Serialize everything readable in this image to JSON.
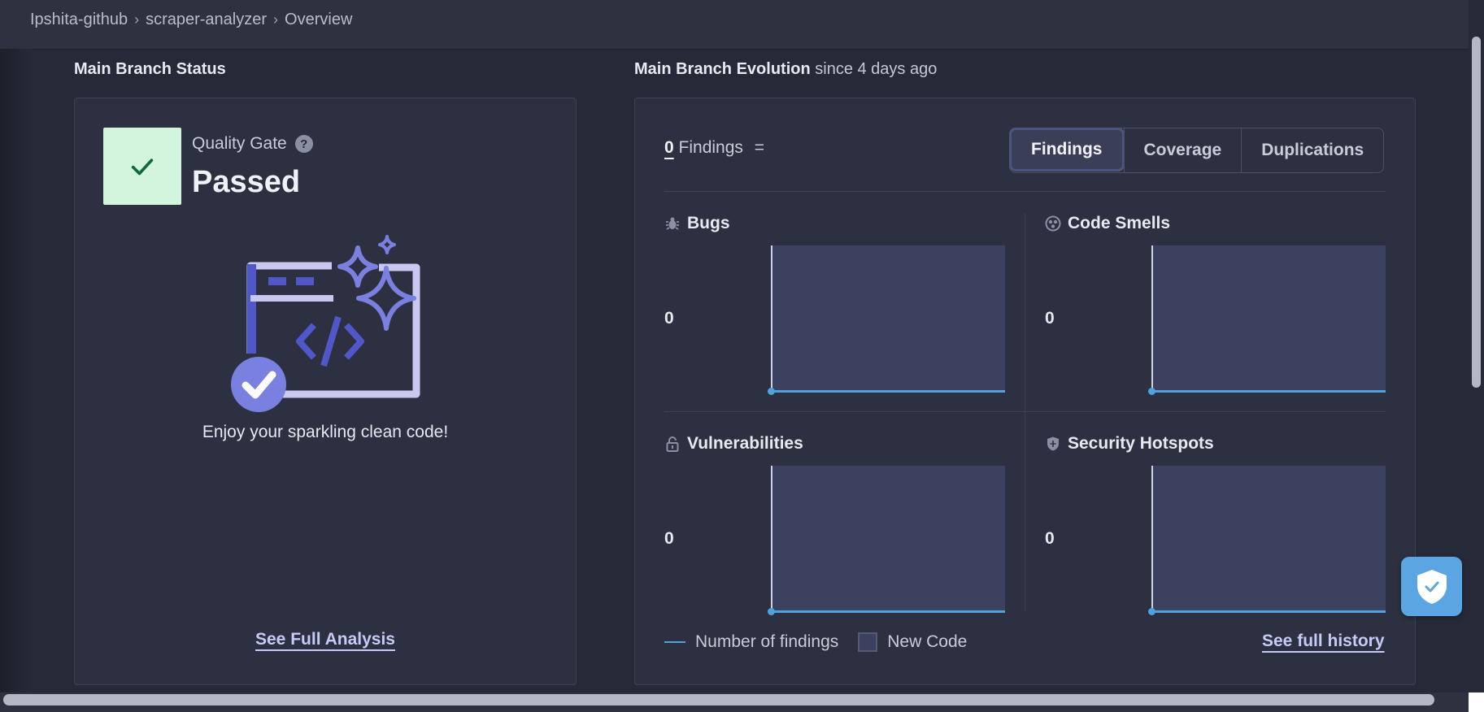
{
  "breadcrumb": {
    "items": [
      {
        "label": "Ipshita-github"
      },
      {
        "label": "scraper-analyzer"
      },
      {
        "label": "Overview"
      }
    ]
  },
  "status_section": {
    "title": "Main Branch Status",
    "quality_gate_label": "Quality Gate",
    "help": "?",
    "status": "Passed",
    "message": "Enjoy your sparkling clean code!",
    "link": "See Full Analysis"
  },
  "evolution_section": {
    "title": "Main Branch Evolution",
    "subtitle": "since 4 days ago",
    "findings_count": "0",
    "findings_label": "Findings",
    "findings_trend": "=",
    "tabs": [
      {
        "label": "Findings",
        "active": true
      },
      {
        "label": "Coverage",
        "active": false
      },
      {
        "label": "Duplications",
        "active": false
      }
    ],
    "metrics": [
      {
        "title": "Bugs",
        "icon": "bug-icon",
        "value": "0"
      },
      {
        "title": "Code Smells",
        "icon": "code-smell-icon",
        "value": "0"
      },
      {
        "title": "Vulnerabilities",
        "icon": "lock-icon",
        "value": "0"
      },
      {
        "title": "Security Hotspots",
        "icon": "shield-icon",
        "value": "0"
      }
    ],
    "legend": {
      "line_label": "Number of findings",
      "new_code_label": "New Code"
    },
    "history_link": "See full history"
  },
  "colors": {
    "accent_line": "#4fa3dc",
    "passed_bg": "#d4f5dd",
    "passed_check": "#0f6b3a",
    "new_code_area": "#3d4160"
  }
}
